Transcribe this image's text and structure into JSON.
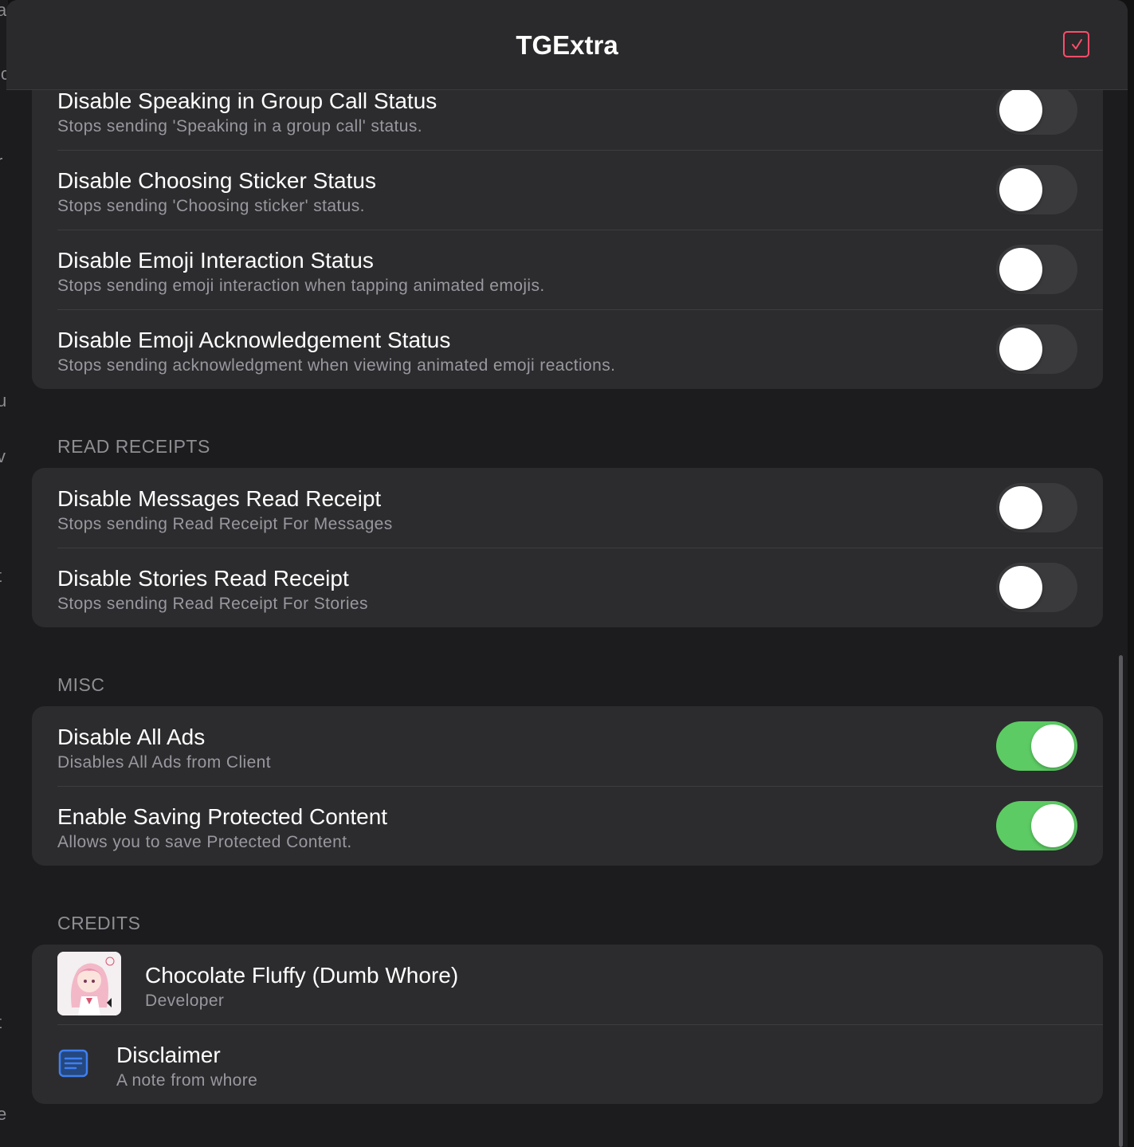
{
  "nav": {
    "title": "TGExtra",
    "done_icon": "checkbox-icon",
    "accent_color": "#ff4d6a"
  },
  "colors": {
    "toggle_on": "#5ccb63",
    "toggle_off": "#3a3a3d",
    "group_bg": "#2c2c2e",
    "sheet_bg": "#1c1c1e",
    "disclaimer_icon": "#3f7ff0"
  },
  "status_group": {
    "items": [
      {
        "title": "Disable Speaking in Group Call Status",
        "subtitle": "Stops sending 'Speaking in a group call' status.",
        "enabled": false
      },
      {
        "title": "Disable Choosing Sticker Status",
        "subtitle": "Stops sending 'Choosing sticker' status.",
        "enabled": false
      },
      {
        "title": "Disable Emoji Interaction Status",
        "subtitle": "Stops sending emoji interaction when tapping animated emojis.",
        "enabled": false
      },
      {
        "title": "Disable Emoji Acknowledgement Status",
        "subtitle": "Stops sending acknowledgment when viewing animated emoji reactions.",
        "enabled": false
      }
    ]
  },
  "read_receipts": {
    "header": "READ RECEIPTS",
    "items": [
      {
        "title": "Disable Messages Read Receipt",
        "subtitle": "Stops sending Read Receipt For Messages",
        "enabled": false
      },
      {
        "title": "Disable Stories Read Receipt",
        "subtitle": "Stops sending Read Receipt For Stories",
        "enabled": false
      }
    ]
  },
  "misc": {
    "header": "MISC",
    "items": [
      {
        "title": "Disable All Ads",
        "subtitle": "Disables All Ads from Client",
        "enabled": true
      },
      {
        "title": "Enable Saving Protected Content",
        "subtitle": "Allows you to save Protected Content.",
        "enabled": true
      }
    ]
  },
  "credits": {
    "header": "CREDITS",
    "developer": {
      "name": "Chocolate Fluffy (Dumb Whore)",
      "role": "Developer",
      "avatar_icon": "developer-avatar"
    },
    "disclaimer": {
      "title": "Disclaimer",
      "subtitle": "A note from whore",
      "icon": "document-icon"
    }
  }
}
